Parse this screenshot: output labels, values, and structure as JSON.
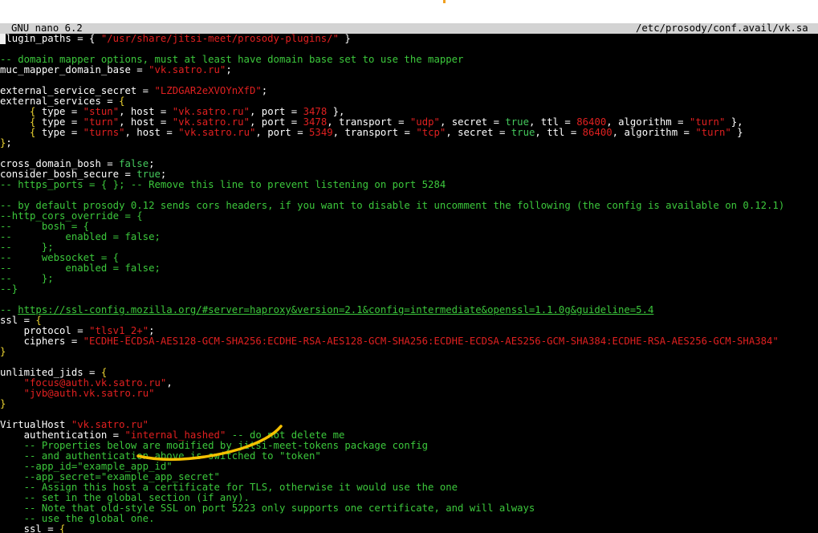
{
  "titlebar": {
    "app": "GNU nano 6.2",
    "path": "/etc/prosody/conf.avail/vk.sa"
  },
  "lines": [
    [
      [
        "k",
        "plugin_paths = { "
      ],
      [
        "s",
        "\"/usr/share/jitsi-meet/prosody-plugins/\""
      ],
      [
        "k",
        " }"
      ]
    ],
    [],
    [
      [
        "c",
        "-- domain mapper options, must at least have domain base set to use the mapper"
      ]
    ],
    [
      [
        "k",
        "muc_mapper_domain_base = "
      ],
      [
        "s",
        "\"vk.satro.ru\""
      ],
      [
        "k",
        ";"
      ]
    ],
    [],
    [
      [
        "k",
        "external_service_secret = "
      ],
      [
        "s",
        "\"LZDGAR2eXVOYnXfD\""
      ],
      [
        "k",
        ";"
      ]
    ],
    [
      [
        "k",
        "external_services = "
      ],
      [
        "y",
        "{"
      ]
    ],
    [
      [
        "k",
        "     "
      ],
      [
        "y",
        "{"
      ],
      [
        "k",
        " type = "
      ],
      [
        "s",
        "\"stun\""
      ],
      [
        "k",
        ", host = "
      ],
      [
        "s",
        "\"vk.satro.ru\""
      ],
      [
        "k",
        ", port = "
      ],
      [
        "s",
        "3478"
      ],
      [
        "k",
        " },"
      ]
    ],
    [
      [
        "k",
        "     "
      ],
      [
        "y",
        "{"
      ],
      [
        "k",
        " type = "
      ],
      [
        "s",
        "\"turn\""
      ],
      [
        "k",
        ", host = "
      ],
      [
        "s",
        "\"vk.satro.ru\""
      ],
      [
        "k",
        ", port = "
      ],
      [
        "s",
        "3478"
      ],
      [
        "k",
        ", transport = "
      ],
      [
        "s",
        "\"udp\""
      ],
      [
        "k",
        ", secret = "
      ],
      [
        "g",
        "true"
      ],
      [
        "k",
        ", ttl = "
      ],
      [
        "s",
        "86400"
      ],
      [
        "k",
        ", algorithm = "
      ],
      [
        "s",
        "\"turn\""
      ],
      [
        "k",
        " },"
      ]
    ],
    [
      [
        "k",
        "     "
      ],
      [
        "y",
        "{"
      ],
      [
        "k",
        " type = "
      ],
      [
        "s",
        "\"turns\""
      ],
      [
        "k",
        ", host = "
      ],
      [
        "s",
        "\"vk.satro.ru\""
      ],
      [
        "k",
        ", port = "
      ],
      [
        "s",
        "5349"
      ],
      [
        "k",
        ", transport = "
      ],
      [
        "s",
        "\"tcp\""
      ],
      [
        "k",
        ", secret = "
      ],
      [
        "g",
        "true"
      ],
      [
        "k",
        ", ttl = "
      ],
      [
        "s",
        "86400"
      ],
      [
        "k",
        ", algorithm = "
      ],
      [
        "s",
        "\"turn\""
      ],
      [
        "k",
        " }"
      ]
    ],
    [
      [
        "y",
        "}"
      ],
      [
        "k",
        ";"
      ]
    ],
    [],
    [
      [
        "k",
        "cross_domain_bosh = "
      ],
      [
        "g",
        "false"
      ],
      [
        "k",
        ";"
      ]
    ],
    [
      [
        "k",
        "consider_bosh_secure = "
      ],
      [
        "g",
        "true"
      ],
      [
        "k",
        ";"
      ]
    ],
    [
      [
        "c",
        "-- https_ports = { }; -- Remove this line to prevent listening on port 5284"
      ]
    ],
    [],
    [
      [
        "c",
        "-- by default prosody 0.12 sends cors headers, if you want to disable it uncomment the following (the config is available on 0.12.1)"
      ]
    ],
    [
      [
        "c",
        "--http_cors_override = {"
      ]
    ],
    [
      [
        "c",
        "--     bosh = {"
      ]
    ],
    [
      [
        "c",
        "--         enabled = false;"
      ]
    ],
    [
      [
        "c",
        "--     };"
      ]
    ],
    [
      [
        "c",
        "--     websocket = {"
      ]
    ],
    [
      [
        "c",
        "--         enabled = false;"
      ]
    ],
    [
      [
        "c",
        "--     };"
      ]
    ],
    [
      [
        "c",
        "--}"
      ]
    ],
    [],
    [
      [
        "c",
        "-- "
      ],
      [
        "u",
        "https://ssl-config.mozilla.org/#server=haproxy&version=2.1&config=intermediate&openssl=1.1.0g&guideline=5.4"
      ]
    ],
    [
      [
        "k",
        "ssl = "
      ],
      [
        "y",
        "{"
      ]
    ],
    [
      [
        "k",
        "    protocol = "
      ],
      [
        "s",
        "\"tlsv1_2+\""
      ],
      [
        "k",
        ";"
      ]
    ],
    [
      [
        "k",
        "    ciphers = "
      ],
      [
        "s",
        "\"ECDHE-ECDSA-AES128-GCM-SHA256:ECDHE-RSA-AES128-GCM-SHA256:ECDHE-ECDSA-AES256-GCM-SHA384:ECDHE-RSA-AES256-GCM-SHA384\""
      ]
    ],
    [
      [
        "y",
        "}"
      ]
    ],
    [],
    [
      [
        "k",
        "unlimited_jids = "
      ],
      [
        "y",
        "{"
      ]
    ],
    [
      [
        "k",
        "    "
      ],
      [
        "s",
        "\"focus@auth.vk.satro.ru\""
      ],
      [
        "k",
        ","
      ]
    ],
    [
      [
        "k",
        "    "
      ],
      [
        "s",
        "\"jvb@auth.vk.satro.ru\""
      ]
    ],
    [
      [
        "y",
        "}"
      ]
    ],
    [],
    [
      [
        "k",
        "VirtualHost "
      ],
      [
        "s",
        "\"vk.satro.ru\""
      ]
    ],
    [
      [
        "k",
        "    authentication = "
      ],
      [
        "s",
        "\"internal_hashed\""
      ],
      [
        "k",
        " "
      ],
      [
        "c",
        "-- do not delete me"
      ]
    ],
    [
      [
        "c",
        "    -- Properties below are modified by jitsi-meet-tokens package config"
      ]
    ],
    [
      [
        "c",
        "    -- and authentication above is switched to \"token\""
      ]
    ],
    [
      [
        "c",
        "    --app_id=\"example_app_id\""
      ]
    ],
    [
      [
        "c",
        "    --app_secret=\"example_app_secret\""
      ]
    ],
    [
      [
        "c",
        "    -- Assign this host a certificate for TLS, otherwise it would use the one"
      ]
    ],
    [
      [
        "c",
        "    -- set in the global section (if any)."
      ]
    ],
    [
      [
        "c",
        "    -- Note that old-style SSL on port 5223 only supports one certificate, and will always"
      ]
    ],
    [
      [
        "c",
        "    -- use the global one."
      ]
    ],
    [
      [
        "k",
        "    ssl = "
      ],
      [
        "y",
        "{"
      ]
    ]
  ],
  "colors": {
    "background": "#000000",
    "comment": "#3cc83c",
    "string": "#e02020",
    "boolean": "#44c85c",
    "brace": "#e8d030",
    "annotation": "#f5c000"
  }
}
